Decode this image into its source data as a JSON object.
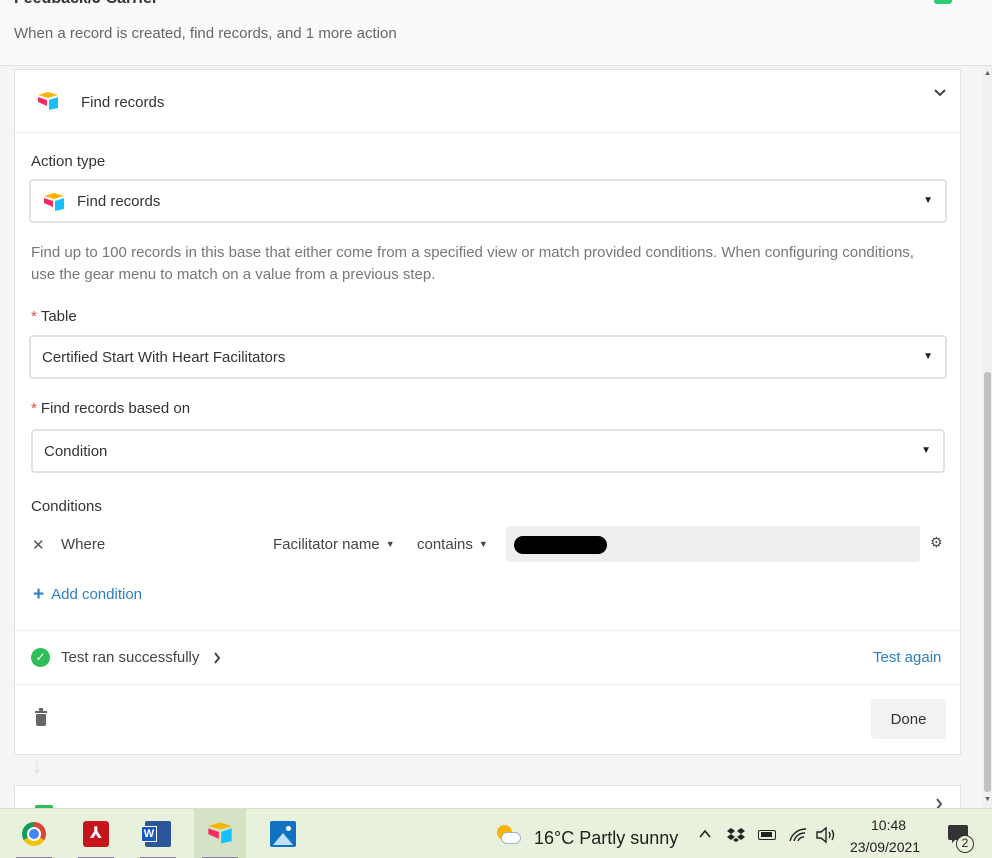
{
  "header": {
    "title": "Feedback/J Carrier",
    "subtitle": "When a record is created, find records, and 1 more action"
  },
  "step": {
    "title": "Find records",
    "action_type_label": "Action type",
    "action_type_value": "Find records",
    "description": "Find up to 100 records in this base that either come from a specified view or match provided conditions. When configuring conditions, use the gear menu to match on a value from a previous step.",
    "required_mark": "*",
    "table_label": "Table",
    "table_value": "Certified Start With Heart Facilitators",
    "based_on_label": "Find records based on",
    "based_on_value": "Condition",
    "conditions_label": "Conditions",
    "condition": {
      "where": "Where",
      "field": "Facilitator name",
      "operator": "contains"
    },
    "add_condition": "Add condition",
    "test_status": "Test ran successfully",
    "test_again": "Test again",
    "done": "Done"
  },
  "taskbar": {
    "weather": "16°C  Partly sunny",
    "time": "10:48",
    "date": "23/09/2021",
    "notification_count": "2"
  },
  "colors": {
    "link": "#2d7fc1",
    "success": "#2ebd59",
    "required": "#e74c3c",
    "taskbar": "#e7f1dc"
  },
  "icons": [
    "airtable-logo-icon",
    "chevron-down-icon",
    "caret-down-icon",
    "close-icon",
    "gear-icon",
    "plus-icon",
    "check-circle-icon",
    "chevron-right-icon",
    "trash-icon",
    "arrow-down-icon",
    "chrome-icon",
    "acrobat-icon",
    "word-icon",
    "photos-icon",
    "weather-icon",
    "dropbox-icon",
    "battery-icon",
    "wifi-icon",
    "volume-icon",
    "notification-icon"
  ]
}
